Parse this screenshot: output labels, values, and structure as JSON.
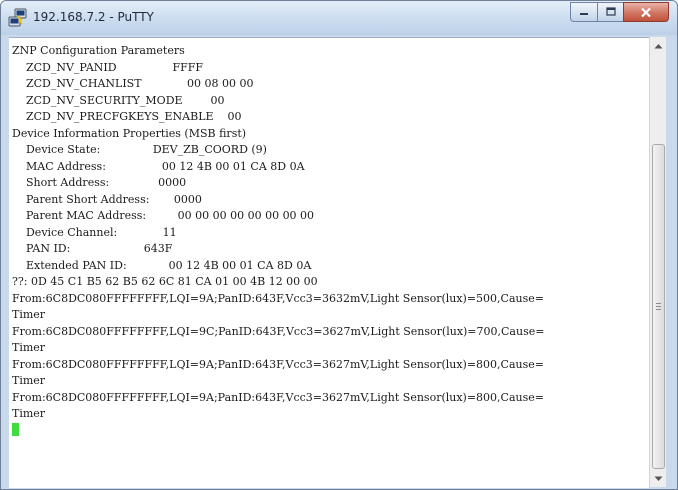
{
  "window": {
    "title": "192.168.7.2 - PuTTY",
    "icon": "putty-app-icon"
  },
  "controls": {
    "minimize_icon": "minimize-icon",
    "maximize_icon": "maximize-icon",
    "close_icon": "close-icon"
  },
  "terminal": {
    "lines": [
      "ZNP Configuration Parameters",
      "    ZCD_NV_PANID                FFFF",
      "    ZCD_NV_CHANLIST             00 08 00 00",
      "    ZCD_NV_SECURITY_MODE        00",
      "    ZCD_NV_PRECFGKEYS_ENABLE    00",
      "Device Information Properties (MSB first)",
      "    Device State:               DEV_ZB_COORD (9)",
      "    MAC Address:                00 12 4B 00 01 CA 8D 0A",
      "    Short Address:              0000",
      "    Parent Short Address:       0000",
      "    Parent MAC Address:         00 00 00 00 00 00 00 00",
      "    Device Channel:             11",
      "    PAN ID:                     643F",
      "    Extended PAN ID:            00 12 4B 00 01 CA 8D 0A",
      "??: 0D 45 C1 B5 62 B5 62 6C 81 CA 01 00 4B 12 00 00",
      "From:6C8DC080FFFFFFFF,LQI=9A;PanID:643F,Vcc3=3632mV,Light Sensor(lux)=500,Cause=",
      "Timer",
      "From:6C8DC080FFFFFFFF,LQI=9C;PanID:643F,Vcc3=3627mV,Light Sensor(lux)=700,Cause=",
      "Timer",
      "From:6C8DC080FFFFFFFF,LQI=9A;PanID:643F,Vcc3=3627mV,Light Sensor(lux)=800,Cause=",
      "Timer",
      "From:6C8DC080FFFFFFFF,LQI=9A;PanID:643F,Vcc3=3627mV,Light Sensor(lux)=800,Cause=",
      "Timer"
    ],
    "cursor_color": "#3fdc3f"
  },
  "scrollbar": {
    "up_icon": "scroll-up-arrow-icon",
    "down_icon": "scroll-down-arrow-icon",
    "position_fraction": 0.72
  },
  "colors": {
    "title_bar": "#cfdff1",
    "close_button": "#c0513b",
    "terminal_background": "#ffffff",
    "terminal_text": "#1c1c1c"
  }
}
